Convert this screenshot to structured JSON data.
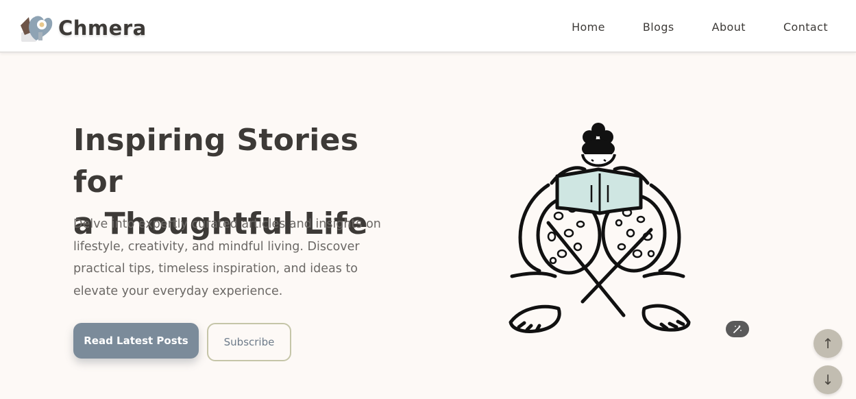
{
  "brand": {
    "name": "Chmera",
    "logo_icon": "heart-mascot-icon"
  },
  "nav": {
    "items": [
      {
        "label": "Home"
      },
      {
        "label": "Blogs"
      },
      {
        "label": "About"
      },
      {
        "label": "Contact"
      }
    ]
  },
  "hero": {
    "title_line1": "Inspiring Stories for",
    "title_line2": "a Thoughtful Life",
    "description": "Delve into expertly curated articles and insights on lifestyle, creativity, and mindful living. Discover practical tips, timeless inspiration, and ideas to elevate your everyday experience.",
    "primary_button": "Read Latest Posts",
    "secondary_button": "Subscribe",
    "illustration_icon": "reading-person-illustration"
  },
  "floating": {
    "wand_icon": "magic-wand-icon",
    "scroll_up_label": "↑",
    "scroll_down_label": "↓"
  },
  "colors": {
    "background": "#fdf9f6",
    "primary_button": "#7b8b9a",
    "secondary_border": "#c5c5a8",
    "book_cover": "#cfe6e2",
    "text_dark": "#3d3a37",
    "scroll_button": "#c2bdb1"
  }
}
